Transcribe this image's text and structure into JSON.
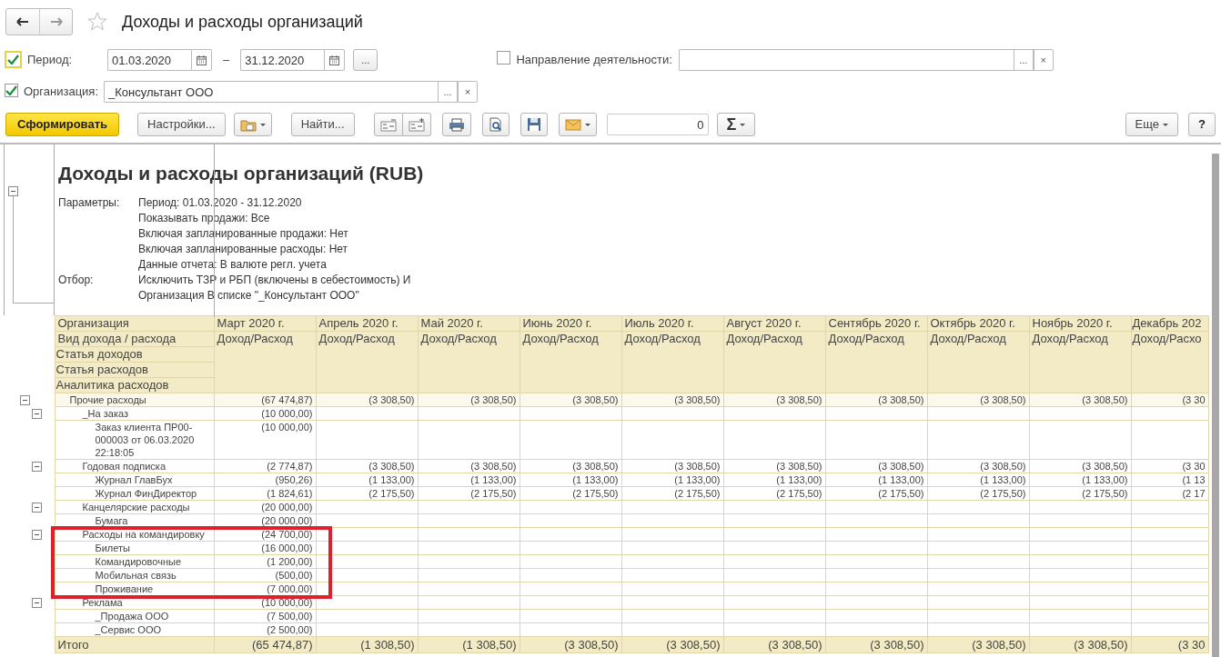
{
  "window": {
    "title": "Доходы и расходы организаций"
  },
  "filters": {
    "period": {
      "label": "Период:",
      "checked": true,
      "focused": true,
      "from": "01.03.2020",
      "to": "31.12.2020",
      "separator": "–",
      "select": "..."
    },
    "direction": {
      "label": "Направление деятельности:",
      "checked": false,
      "select": "...",
      "clear": "×"
    },
    "organization": {
      "label": "Организация:",
      "checked": true,
      "value": "_Консультант ООО",
      "select": "...",
      "clear": "×"
    }
  },
  "toolbar": {
    "generate": "Сформировать",
    "settings": "Настройки...",
    "find": "Найти...",
    "count_value": "0",
    "sum": "Σ",
    "more": "Еще",
    "help": "?"
  },
  "report": {
    "title": "Доходы и расходы организаций (RUB)",
    "params": [
      {
        "label": "Параметры:",
        "lines": [
          "Период: 01.03.2020 - 31.12.2020",
          "Показывать продажи: Все",
          "Включая запланированные продажи: Нет",
          "Включая запланированные расходы: Нет",
          "Данные отчета: В валюте регл. учета"
        ]
      },
      {
        "label": "Отбор:",
        "lines": [
          "Исключить ТЗР и РБП (включены в себестоимость) И",
          "Организация В списке \"_Консультант ООО\""
        ]
      }
    ],
    "header_labels": [
      "Организация",
      "Вид дохода / расхода",
      "Статья доходов",
      "Статья расходов",
      "Аналитика расходов"
    ],
    "columns": [
      {
        "period": "Март 2020 г.",
        "measure": "Доход/Расход"
      },
      {
        "period": "Апрель 2020 г.",
        "measure": "Доход/Расход"
      },
      {
        "period": "Май 2020 г.",
        "measure": "Доход/Расход"
      },
      {
        "period": "Июнь 2020 г.",
        "measure": "Доход/Расход"
      },
      {
        "period": "Июль 2020 г.",
        "measure": "Доход/Расход"
      },
      {
        "period": "Август 2020 г.",
        "measure": "Доход/Расход"
      },
      {
        "period": "Сентябрь 2020 г.",
        "measure": "Доход/Расход"
      },
      {
        "period": "Октябрь 2020 г.",
        "measure": "Доход/Расход"
      },
      {
        "period": "Ноябрь 2020 г.",
        "measure": "Доход/Расход"
      },
      {
        "period": "Декабрь 202",
        "measure": "Доход/Расхо"
      }
    ],
    "rows": [
      {
        "label": "Прочие расходы",
        "expanded": true,
        "values": [
          "(67 474,87)",
          "(3 308,50)",
          "(3 308,50)",
          "(3 308,50)",
          "(3 308,50)",
          "(3 308,50)",
          "(3 308,50)",
          "(3 308,50)",
          "(3 308,50)",
          "(3 30"
        ],
        "children": [
          {
            "label": "_На заказ",
            "expanded": true,
            "highlighted": false,
            "values": [
              "(10 000,00)"
            ],
            "children": [
              {
                "label": "Заказ клиента ПР00-000003 от 06.03.2020 22:18:05",
                "values": [
                  "(10 000,00)"
                ]
              }
            ]
          },
          {
            "label": "Годовая подписка",
            "expanded": true,
            "highlighted": false,
            "values": [
              "(2 774,87)",
              "(3 308,50)",
              "(3 308,50)",
              "(3 308,50)",
              "(3 308,50)",
              "(3 308,50)",
              "(3 308,50)",
              "(3 308,50)",
              "(3 308,50)",
              "(3 30"
            ],
            "children": [
              {
                "label": "Журнал ГлавБух",
                "values": [
                  "(950,26)",
                  "(1 133,00)",
                  "(1 133,00)",
                  "(1 133,00)",
                  "(1 133,00)",
                  "(1 133,00)",
                  "(1 133,00)",
                  "(1 133,00)",
                  "(1 133,00)",
                  "(1 13"
                ]
              },
              {
                "label": "Журнал ФинДиректор",
                "values": [
                  "(1 824,61)",
                  "(2 175,50)",
                  "(2 175,50)",
                  "(2 175,50)",
                  "(2 175,50)",
                  "(2 175,50)",
                  "(2 175,50)",
                  "(2 175,50)",
                  "(2 175,50)",
                  "(2 17"
                ]
              }
            ]
          },
          {
            "label": "Канцелярские расходы",
            "expanded": true,
            "highlighted": false,
            "values": [
              "(20 000,00)"
            ],
            "children": [
              {
                "label": "Бумага",
                "values": [
                  "(20 000,00)"
                ]
              }
            ]
          },
          {
            "label": "Расходы на командировку",
            "expanded": true,
            "highlighted": true,
            "values": [
              "(24 700,00)"
            ],
            "children": [
              {
                "label": "Билеты",
                "values": [
                  "(16 000,00)"
                ]
              },
              {
                "label": "Командировочные",
                "values": [
                  "(1 200,00)"
                ]
              },
              {
                "label": "Мобильная связь",
                "values": [
                  "(500,00)"
                ]
              },
              {
                "label": "Проживание",
                "values": [
                  "(7 000,00)"
                ]
              }
            ]
          },
          {
            "label": "Реклама",
            "expanded": true,
            "highlighted": false,
            "values": [
              "(10 000,00)"
            ],
            "children": [
              {
                "label": "_Продажа ООО",
                "values": [
                  "(7 500,00)"
                ]
              },
              {
                "label": "_Сервис ООО",
                "values": [
                  "(2 500,00)"
                ]
              }
            ]
          }
        ]
      }
    ],
    "total": {
      "label": "Итого",
      "values": [
        "(65 474,87)",
        "(1 308,50)",
        "(1 308,50)",
        "(3 308,50)",
        "(3 308,50)",
        "(3 308,50)",
        "(3 308,50)",
        "(3 308,50)",
        "(3 308,50)",
        "(3 30"
      ]
    }
  }
}
